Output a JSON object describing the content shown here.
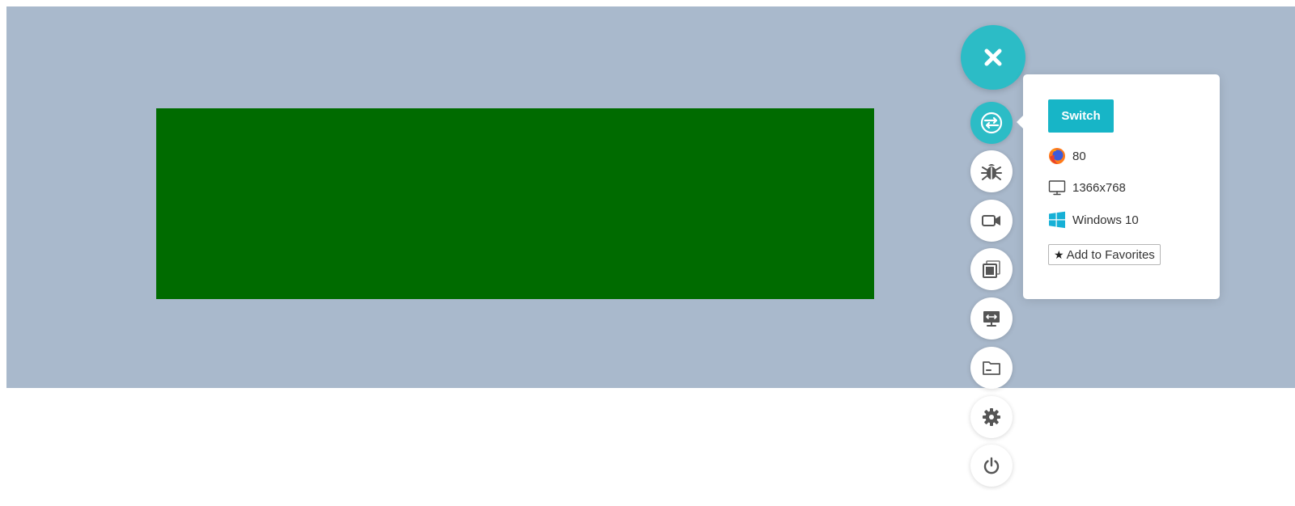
{
  "popover": {
    "switch_label": "Switch",
    "browser_version": "80",
    "resolution": "1366x768",
    "os": "Windows 10",
    "favorites_label": "Add to Favorites"
  },
  "toolbar": {
    "items": [
      {
        "name": "switch-session",
        "icon": "switch-icon",
        "active": true
      },
      {
        "name": "debug",
        "icon": "bug-icon"
      },
      {
        "name": "record-video",
        "icon": "video-camera-icon"
      },
      {
        "name": "screenshots",
        "icon": "screenshots-icon"
      },
      {
        "name": "change-resolution",
        "icon": "monitor-resolution-icon"
      },
      {
        "name": "files",
        "icon": "folder-icon"
      },
      {
        "name": "settings",
        "icon": "gear-icon"
      },
      {
        "name": "stop-session",
        "icon": "power-icon"
      }
    ]
  },
  "colors": {
    "accent": "#2cbcc6",
    "switch_button": "#17b5c7",
    "stage_background": "#a9b9cc",
    "content_block": "#006b00",
    "icon_gray": "#555555"
  }
}
